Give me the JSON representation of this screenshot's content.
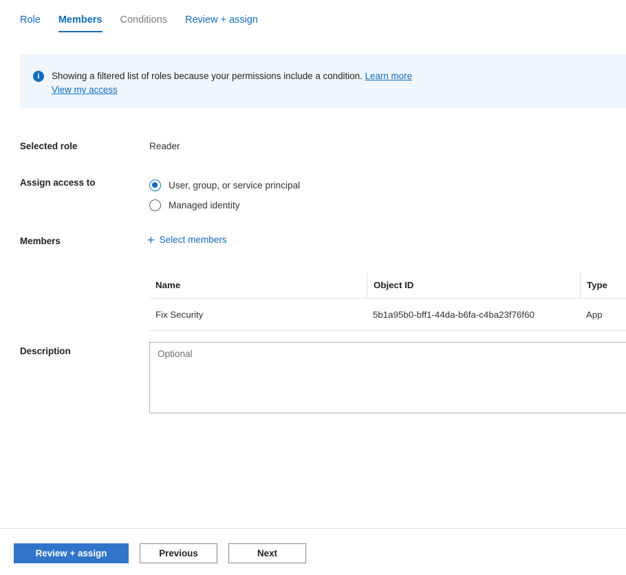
{
  "tabs": [
    {
      "label": "Role",
      "state": "link"
    },
    {
      "label": "Members",
      "state": "active"
    },
    {
      "label": "Conditions",
      "state": "disabled"
    },
    {
      "label": "Review + assign",
      "state": "link"
    }
  ],
  "banner": {
    "icon": "info-icon",
    "message": "Showing a filtered list of roles because your permissions include a condition.",
    "learn_more": "Learn more",
    "view_my_access": "View my access",
    "background": "#eff6fc",
    "accent": "#0f6cbd"
  },
  "fields": {
    "selected_role_label": "Selected role",
    "selected_role_value": "Reader",
    "assign_access_label": "Assign access to",
    "assign_access_options": [
      {
        "label": "User, group, or service principal",
        "checked": true
      },
      {
        "label": "Managed identity",
        "checked": false
      }
    ],
    "members_label": "Members",
    "select_members_link": "Select members",
    "select_members_icon": "plus-icon",
    "description_label": "Description",
    "description_value": "",
    "description_placeholder": "Optional"
  },
  "members_table": {
    "columns": [
      "Name",
      "Object ID",
      "Type"
    ],
    "rows": [
      {
        "name": "Fix Security",
        "object_id": "5b1a95b0-bff1-44da-b6fa-c4ba23f76f60",
        "type": "App"
      }
    ]
  },
  "footer": {
    "primary_button": "Review + assign",
    "previous_button": "Previous",
    "next_button": "Next",
    "primary_color": "#3075c9"
  }
}
